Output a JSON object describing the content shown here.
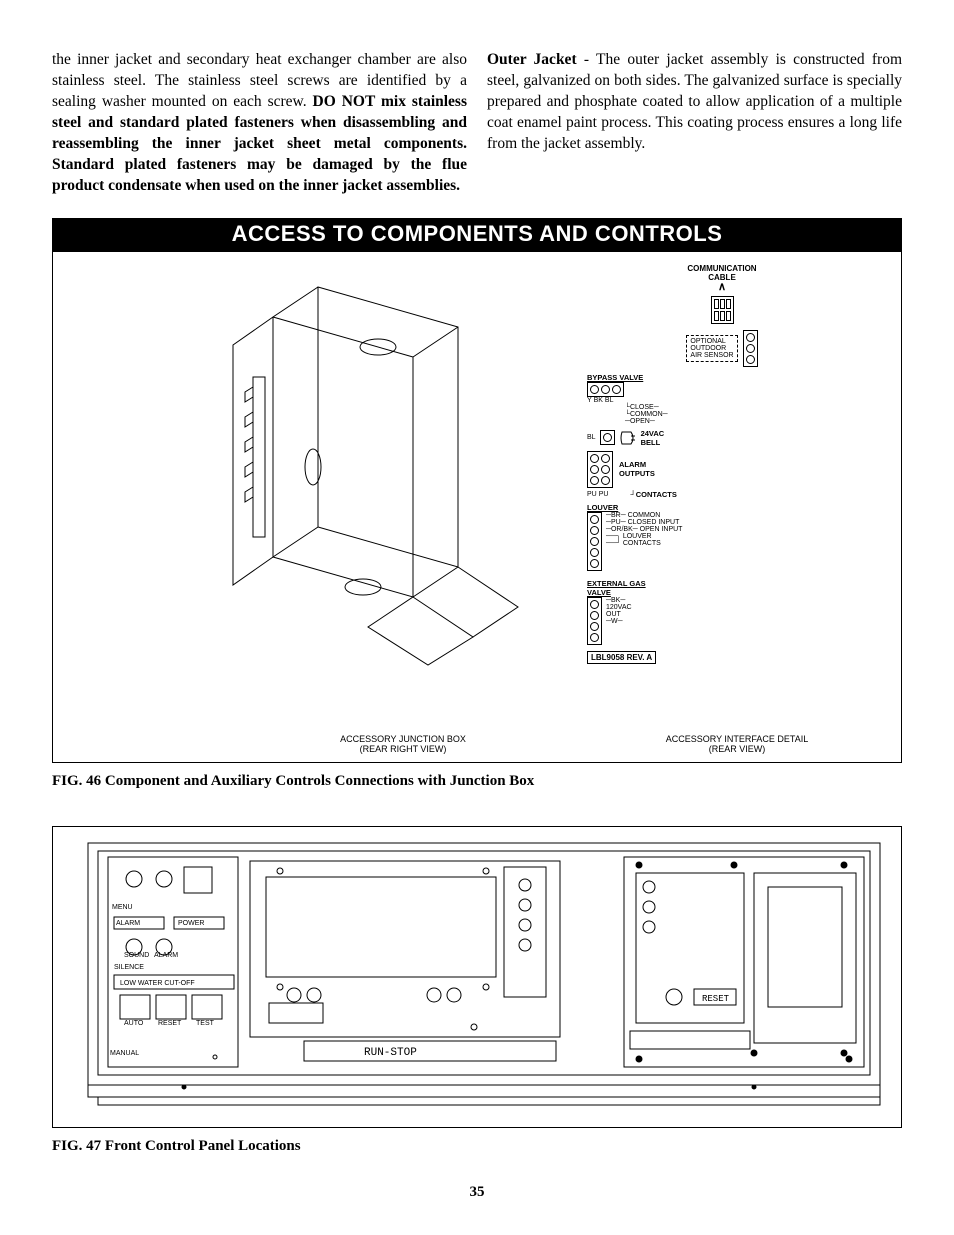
{
  "paragraphs": {
    "left_part1": "the inner jacket and secondary heat exchanger chamber are also stainless steel. The stainless steel screws are identified by a sealing washer mounted on each screw.  ",
    "left_bold": "DO NOT mix stainless steel and standard plated fasteners when disassembling and reassembling the inner jacket sheet metal  components. Standard plated fasteners may be damaged by the flue product condensate when used on the inner jacket assemblies.",
    "right_bold_lead": "Outer Jacket",
    "right_body": " - The outer jacket assembly is constructed from steel, galvanized on both sides.  The galvanized surface is specially prepared and phosphate coated to allow application of a multiple coat enamel paint process. This coating process ensures a long life from the jacket assembly."
  },
  "section_heading": "ACCESS TO COMPONENTS AND CONTROLS",
  "fig46": {
    "caption": "FIG. 46   Component and Auxiliary Controls Connections with Junction Box",
    "sub_caption_left_line1": "ACCESSORY JUNCTION BOX",
    "sub_caption_left_line2": "(REAR RIGHT VIEW)",
    "sub_caption_right_line1": "ACCESSORY INTERFACE DETAIL",
    "sub_caption_right_line2": "(REAR VIEW)",
    "side_labels": {
      "comm_cable": "COMMUNICATION\nCABLE",
      "optional_sensor": "OPTIONAL\nOUTDOOR\nAIR SENSOR",
      "bypass_valve": "BYPASS VALVE",
      "bypass_wires": [
        "Y",
        "BK",
        "BL"
      ],
      "bypass_terms": [
        "CLOSE",
        "COMMON",
        "OPEN"
      ],
      "bell": "24VAC\nBELL",
      "bell_wire": "BL",
      "alarm": "ALARM\nOUTPUTS",
      "contacts": "CONTACTS",
      "contacts_wires": [
        "PU",
        "PU"
      ],
      "louver": "LOUVER",
      "louver_rows": [
        {
          "wire": "BR",
          "label": "COMMON"
        },
        {
          "wire": "PU",
          "label": "CLOSED INPUT"
        },
        {
          "wire": "OR/BK",
          "label": "OPEN INPUT"
        }
      ],
      "louver_contacts": "LOUVER\nCONTACTS",
      "ext_gas": "EXTERNAL GAS\nVALVE",
      "ext_rows": [
        {
          "wire": "BK",
          "label": ""
        },
        {
          "wire": "",
          "label": "120VAC\nOUT"
        },
        {
          "wire": "W",
          "label": ""
        }
      ],
      "rev": "LBL9058 REV. A"
    }
  },
  "fig47": {
    "caption": "FIG. 47   Front Control Panel Locations",
    "labels": {
      "alarm": "ALARM",
      "power": "POWER",
      "silence": "SILENCE",
      "lwco": "LOW WATER CUT-OFF",
      "auto": "AUTO",
      "reset_sm": "RESET",
      "test": "TEST",
      "manual": "MANUAL",
      "runstop": "RUN-STOP",
      "reset": "RESET",
      "menu": "MENU",
      "sound": "SOUND",
      "alarm_sm": "ALARM"
    }
  },
  "page_number": "35"
}
